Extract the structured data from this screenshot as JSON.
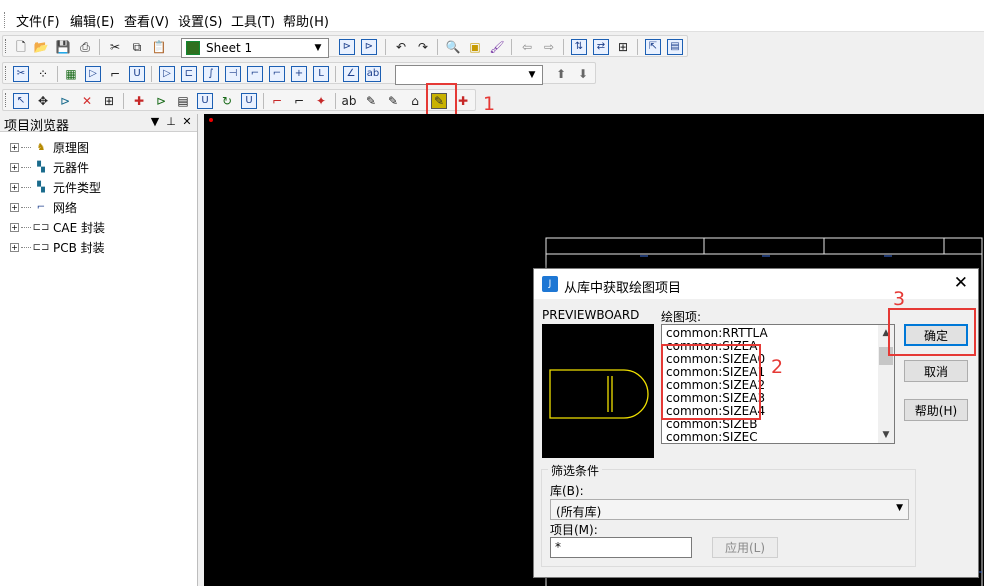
{
  "menu": [
    "文件(F)",
    "编辑(E)",
    "查看(V)",
    "设置(S)",
    "工具(T)",
    "帮助(H)"
  ],
  "toolbar": {
    "sheet_select": "Sheet 1"
  },
  "annotations": [
    "1",
    "2",
    "3"
  ],
  "project_browser": {
    "title": "项目浏览器",
    "pin": "⊥",
    "close": "✕",
    "items": [
      "原理图",
      "元器件",
      "元件类型",
      "网络",
      "CAE 封装",
      "PCB 封装"
    ]
  },
  "dialog": {
    "title": "从库中获取绘图项目",
    "preview_label": "PREVIEWBOARD",
    "list_label": "绘图项:",
    "list_items": [
      "common:RRTTLA",
      "common:SIZEA",
      "common:SIZEA0",
      "common:SIZEA1",
      "common:SIZEA2",
      "common:SIZEA3",
      "common:SIZEA4",
      "common:SIZEB",
      "common:SIZEC"
    ],
    "buttons": {
      "ok": "确定",
      "cancel": "取消",
      "help": "帮助(H)"
    },
    "filter": {
      "legend": "筛选条件",
      "library_label": "库(B):",
      "library_value": "(所有库)",
      "item_label": "项目(M):",
      "item_value": "*",
      "apply": "应用(L)"
    }
  }
}
